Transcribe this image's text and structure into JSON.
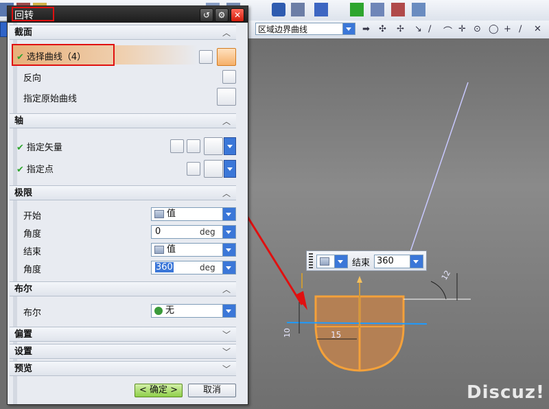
{
  "dialog": {
    "title": "回转",
    "title_buttons": [
      "reset-icon",
      "gear-icon",
      "close-icon"
    ],
    "sections": {
      "section": {
        "title": "截面",
        "select_curve": "选择曲线（4）",
        "reverse": "反向",
        "specify_original_curve": "指定原始曲线"
      },
      "axis": {
        "title": "轴",
        "specify_vector": "指定矢量",
        "specify_point": "指定点"
      },
      "limits": {
        "title": "极限",
        "start_label": "开始",
        "start_option": "值",
        "start_angle_label": "角度",
        "start_angle_value": "0",
        "start_angle_unit": "deg",
        "end_label": "结束",
        "end_option": "值",
        "end_angle_label": "角度",
        "end_angle_value": "360",
        "end_angle_unit": "deg"
      },
      "boolean": {
        "title": "布尔",
        "label": "布尔",
        "value": "无"
      },
      "offset": {
        "title": "偏置"
      },
      "settings": {
        "title": "设置"
      },
      "preview": {
        "title": "预览"
      }
    },
    "ok_label": "< 确定 >",
    "cancel_label": "取消"
  },
  "toolbar": {
    "selection_filter": "区域边界曲线"
  },
  "viewport": {
    "popup_label": "结束",
    "popup_value": "360",
    "dim_15": "15",
    "dim_10": "10",
    "dim_12": "12"
  },
  "watermark": "Discuz!",
  "colors": {
    "highlight_red": "#e01010",
    "check_green": "#2ea52e",
    "dropdown_blue": "#3b77d8",
    "part_fill": "#c88c4e",
    "axis_blue": "#1e9bff"
  }
}
